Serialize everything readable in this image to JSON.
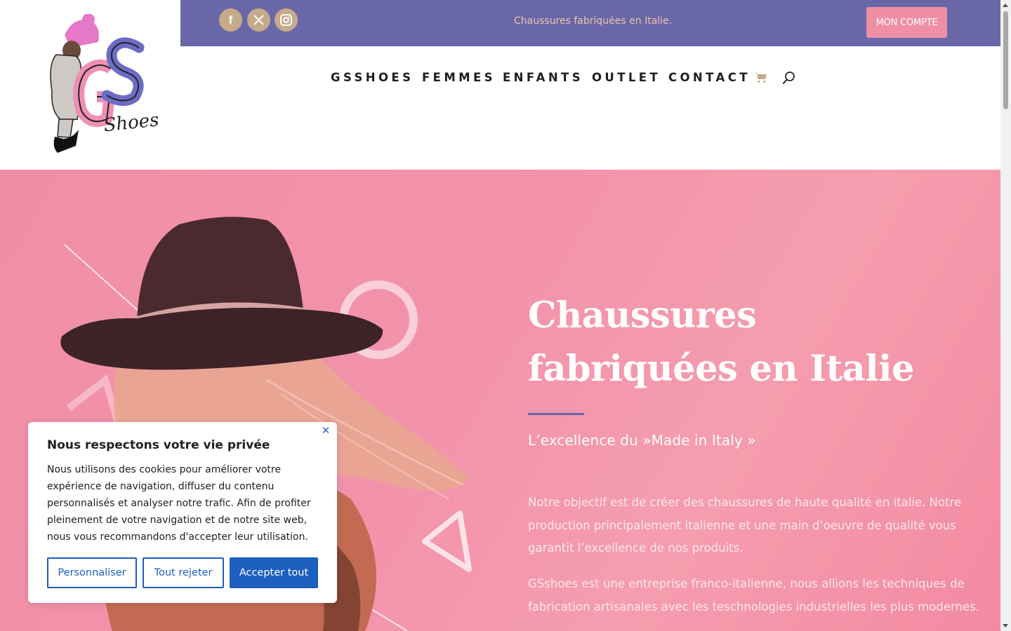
{
  "brand": {
    "logo_name": "GS Shoes",
    "logo_script": "Shoes"
  },
  "topbar": {
    "social": [
      {
        "label": "f",
        "icon": "facebook-icon"
      },
      {
        "label": "X",
        "icon": "x-twitter-icon"
      },
      {
        "label": "instagram",
        "icon": "instagram-icon"
      }
    ],
    "tagline": "Chaussures fabriquées en Italie.",
    "account_button": "MON COMPTE"
  },
  "nav": {
    "items": [
      "GSSHOES",
      "FEMMES",
      "ENFANTS",
      "OUTLET",
      "CONTACT"
    ],
    "cart_icon": "cart-icon",
    "search_icon": "search-icon"
  },
  "hero": {
    "title": "Chaussures fabriquées en Italie",
    "subtitle": "L’excellence du  »Made in Italy »",
    "paragraph1": "Notre objectif est de créer des chaussures de haute qualité en italie. Notre production principalement italienne et une main d’oeuvre de qualité vous garantit l’excellence de nos produits.",
    "paragraph2": "GSshoes est une entreprise franco-italienne, nous allions les techniques de fabrication artisanales avec les teschnologies industrielles les plus modernes."
  },
  "cookie": {
    "title": "Nous respectons votre vie privée",
    "text": "Nous utilisons des cookies pour améliorer votre expérience de navigation, diffuser du contenu personnalisés et analyser notre trafic. Afin de profiter pleinement de votre navigation et de notre site web, nous vous recommandons d'accepter leur utilisation.",
    "buttons": {
      "customize": "Personnaliser",
      "reject": "Tout rejeter",
      "accept": "Accepter tout"
    },
    "close_icon": "close-icon"
  },
  "colors": {
    "topbar": "#6a67a8",
    "accent_pink": "#ee8fa6",
    "hero_bg": "#f393ab",
    "social_bg": "#c6aa8c",
    "cookie_blue": "#1d5fbf"
  }
}
